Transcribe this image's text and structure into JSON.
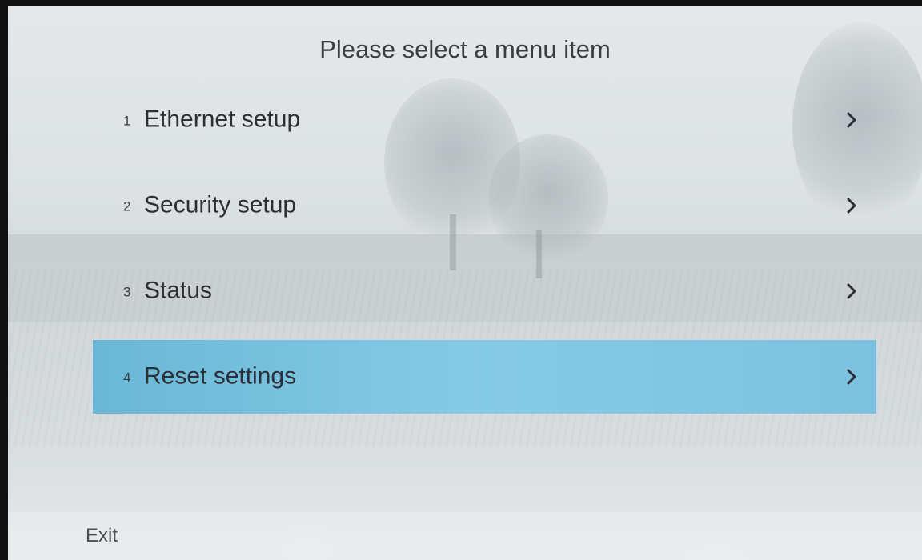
{
  "screen": {
    "title": "Please select a menu item"
  },
  "menu": {
    "items": [
      {
        "number": "1",
        "label": "Ethernet setup",
        "icon": "chevron-right-icon",
        "selected": false
      },
      {
        "number": "2",
        "label": "Security setup",
        "icon": "chevron-right-icon",
        "selected": false
      },
      {
        "number": "3",
        "label": "Status",
        "icon": "chevron-right-icon",
        "selected": false
      },
      {
        "number": "4",
        "label": "Reset settings",
        "icon": "chevron-right-icon",
        "selected": true
      }
    ]
  },
  "footer": {
    "exit_label": "Exit"
  },
  "colors": {
    "selected_bg": "#7cc2de",
    "text": "#2c3036",
    "background": "#dde2e4"
  }
}
